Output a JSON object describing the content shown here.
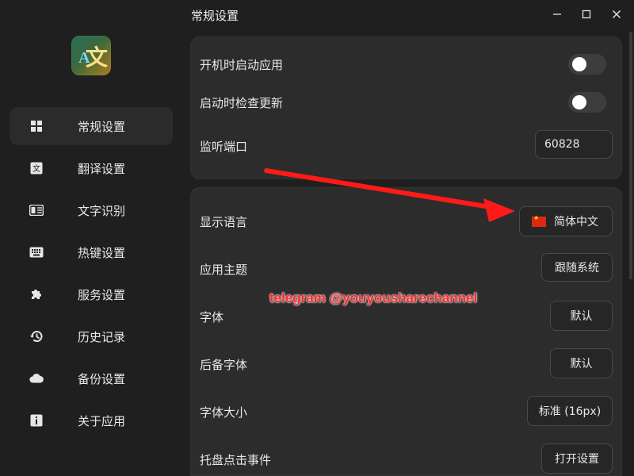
{
  "window": {
    "title": "常规设置"
  },
  "sidebar": {
    "items": [
      {
        "label": "常规设置",
        "icon": "grid-icon",
        "active": true
      },
      {
        "label": "翻译设置",
        "icon": "translate-icon",
        "active": false
      },
      {
        "label": "文字识别",
        "icon": "ocr-icon",
        "active": false
      },
      {
        "label": "热键设置",
        "icon": "keyboard-icon",
        "active": false
      },
      {
        "label": "服务设置",
        "icon": "puzzle-icon",
        "active": false
      },
      {
        "label": "历史记录",
        "icon": "history-icon",
        "active": false
      },
      {
        "label": "备份设置",
        "icon": "cloud-icon",
        "active": false
      },
      {
        "label": "关于应用",
        "icon": "info-icon",
        "active": false
      }
    ]
  },
  "general": {
    "autostart_label": "开机时启动应用",
    "check_update_label": "启动时检查更新",
    "port_label": "监听端口",
    "port_value": "60828"
  },
  "appearance": {
    "language_label": "显示语言",
    "language_value": "简体中文",
    "theme_label": "应用主题",
    "theme_value": "跟随系统",
    "font_label": "字体",
    "font_value": "默认",
    "fallback_font_label": "后备字体",
    "fallback_font_value": "默认",
    "font_size_label": "字体大小",
    "font_size_value": "标准 (16px)",
    "tray_click_label": "托盘点击事件",
    "tray_click_value": "打开设置"
  },
  "overlay": {
    "watermark": "telegram @youyousharechannel"
  },
  "colors": {
    "background": "#1f1f1f",
    "card": "#2c2c2c",
    "accent_red": "#ff1a1a"
  }
}
